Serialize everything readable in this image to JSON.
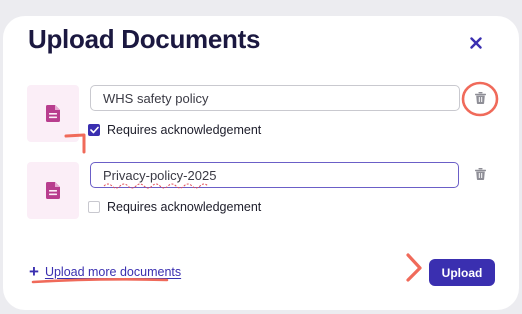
{
  "dialog": {
    "title": "Upload Documents",
    "close_icon": "close-icon"
  },
  "documents": [
    {
      "name": "WHS safety policy",
      "requires_ack_label": "Requires acknowledgement",
      "requires_ack": true,
      "thumb_icon": "document-icon",
      "delete_icon": "trash-icon"
    },
    {
      "name": "Privacy-policy-2025",
      "requires_ack_label": "Requires acknowledgement",
      "requires_ack": false,
      "thumb_icon": "document-icon",
      "delete_icon": "trash-icon"
    }
  ],
  "footer": {
    "upload_more_label": "Upload more documents",
    "upload_button_label": "Upload"
  },
  "colors": {
    "accent": "#3a2fb0",
    "thumb_bg": "#fbeef7",
    "doc_icon": "#b83d8e",
    "annotation": "#f06a5a"
  }
}
